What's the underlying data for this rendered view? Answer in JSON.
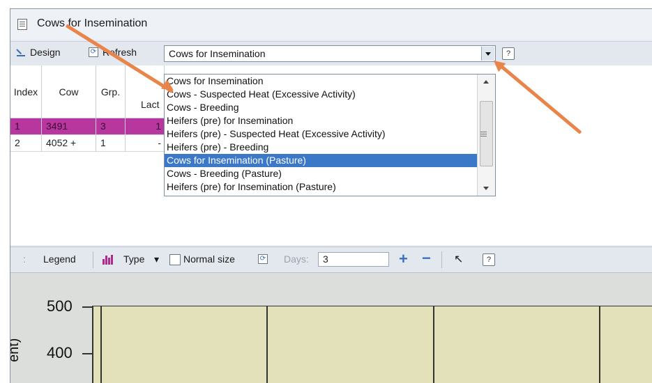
{
  "window": {
    "title": "Cows for Insemination"
  },
  "toolbar": {
    "design_label": "Design",
    "refresh_label": "Refresh",
    "report_selected": "Cows for Insemination",
    "help_label": "?"
  },
  "report_list": {
    "items": [
      "Cows for Insemination",
      "Cows - Suspected Heat (Excessive Activity)",
      "Cows - Breeding",
      "Heifers (pre) for Insemination",
      "Heifers (pre) - Suspected Heat (Excessive Activity)",
      "Heifers (pre) - Breeding",
      "Cows for Insemination (Pasture)",
      "Cows - Breeding (Pasture)",
      "Heifers (pre) for Insemination (Pasture)"
    ],
    "highlighted": "Cows for Insemination (Pasture)"
  },
  "table": {
    "headers": [
      "Index",
      "Cow",
      "Grp.",
      "Lact"
    ],
    "rows": [
      {
        "index": "1",
        "cow": "3491",
        "grp": "3",
        "lact": "1",
        "selected": true
      },
      {
        "index": "2",
        "cow": "4052 +",
        "grp": "1",
        "lact": "-",
        "selected": false
      }
    ]
  },
  "chart_toolbar": {
    "grip": ":",
    "legend_label": "Legend",
    "type_label": "Type",
    "type_arrow": "▾",
    "normal_size_label": "Normal size",
    "days_label": "Days:",
    "days_value": "3",
    "plus": "+",
    "minus": "−",
    "help_label": "?"
  },
  "chart": {
    "y_axis_title": "ent)",
    "y_ticks": [
      "500",
      "400"
    ]
  },
  "colors": {
    "selected_row": "#b7379e",
    "highlight": "#3b78c8",
    "plot_bg": "#e2e1b9",
    "arrow": "#e8854a"
  }
}
